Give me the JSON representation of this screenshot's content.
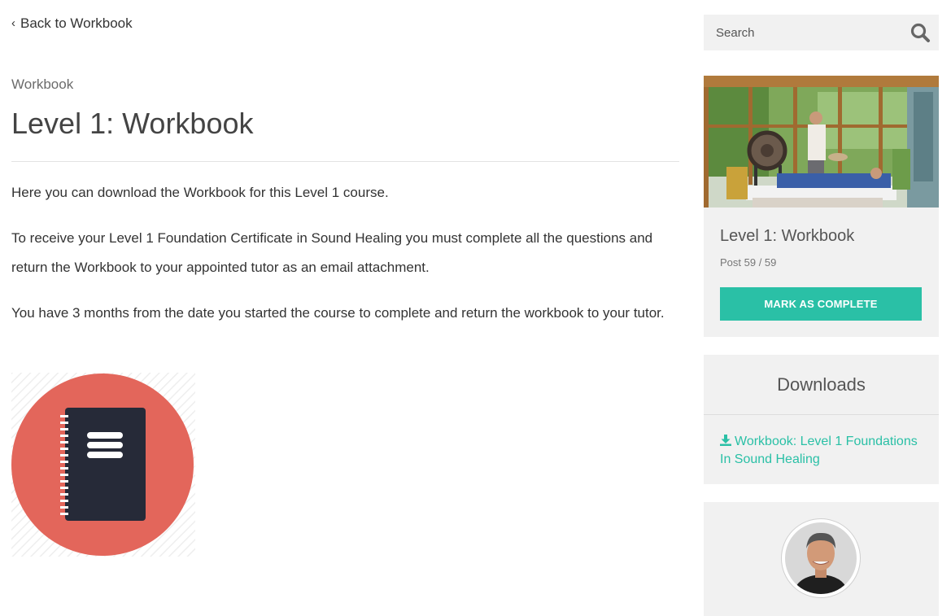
{
  "nav": {
    "back_label": "Back to Workbook",
    "back_icon": "chevron-left-icon"
  },
  "main": {
    "kicker": "Workbook",
    "title": "Level 1: Workbook",
    "paragraphs": [
      "Here you can download the Workbook for this Level 1 course.",
      "To receive your Level 1 Foundation Certificate in Sound Healing you must complete all the questions and return the Workbook to your appointed tutor as an email attachment.",
      "You have 3 months from the date you started the course to complete and return the workbook to your tutor."
    ],
    "illustration_icon": "notebook-icon"
  },
  "sidebar": {
    "search": {
      "placeholder": "Search",
      "value": "",
      "icon": "search-icon"
    },
    "lesson": {
      "title": "Level 1: Workbook",
      "progress": "Post 59 / 59",
      "complete_label": "MARK AS COMPLETE"
    },
    "downloads": {
      "title": "Downloads",
      "items": [
        {
          "label": "Workbook: Level 1 Foundations In Sound Healing",
          "icon": "download-icon"
        }
      ]
    }
  },
  "colors": {
    "accent": "#2ac0a6",
    "card_bg": "#f1f1f1",
    "illustration_circle": "#e3665b",
    "notebook": "#262a38"
  }
}
